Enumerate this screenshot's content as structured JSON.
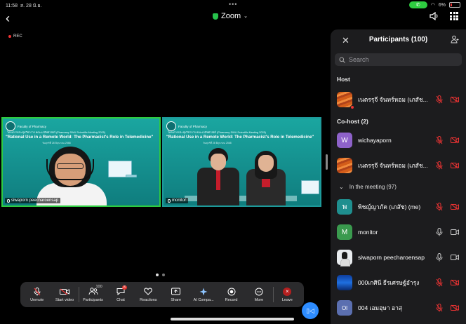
{
  "status": {
    "time": "11:58",
    "date": "ส. 28 มิ.ย.",
    "battery": "6%"
  },
  "topbar": {
    "app_name": "Zoom",
    "recording_label": "REC"
  },
  "tiles": [
    {
      "name": "siwaporn peecharoensap",
      "faculty": "Faculty of Pharmacy",
      "event": "โครงการประชุมวิชาการ คณะเภสัชศาสตร์ (Pharmacy SWU Scientific Meeting 2025)",
      "headline": "\"Rational Use in a Remote World: The Pharmacist's Role in Telemedicine\"",
      "subline": "วันศุกร์ที่ 28 มิถุนายน 2568"
    },
    {
      "name": "monitor",
      "faculty": "Faculty of Pharmacy",
      "event": "โครงการประชุมวิชาการ คณะเภสัชศาสตร์ (Pharmacy SWU Scientific Meeting 2025)",
      "headline": "\"Rational Use in a Remote World: The Pharmacist's Role in Telemedicine\"",
      "subline": "วันศุกร์ที่ 28 มิถุนายน 2568"
    }
  ],
  "toolbar": {
    "unmute": "Unmute",
    "start_video": "Start video",
    "participants": "Participants",
    "participants_count": "100",
    "chat": "Chat",
    "chat_badge": "8",
    "reactions": "Reactions",
    "share": "Share",
    "ai_companion": "AI Compa...",
    "record": "Record",
    "more": "More",
    "leave": "Leave"
  },
  "panel": {
    "title": "Participants (100)",
    "search_placeholder": "Search",
    "host_label": "Host",
    "cohost_label": "Co-host (2)",
    "meeting_label": "In the meeting (97)",
    "host": {
      "name": "เนตรรุจี จันทร์หอม (เภสัช...",
      "avatar_type": "orange-image"
    },
    "cohosts": [
      {
        "name": "wichayaporn",
        "initial": "W",
        "avatar_color": "#8e62c9"
      },
      {
        "name": "เนตรรุจี จันทร์หอม (เภสัช...",
        "avatar_type": "orange-image"
      }
    ],
    "attendees": [
      {
        "name": "พิชญ์ญาภัค (เภสัช) (me)",
        "initial": "พ",
        "avatar_color": "#1f8f8f"
      },
      {
        "name": "monitor",
        "initial": "M",
        "avatar_color": "#3a9a4e"
      },
      {
        "name": "siwaporn peecharoensap",
        "avatar_type": "person-image"
      },
      {
        "name": "000เกศินี ธีรเศรษฐ์อำรุง",
        "avatar_type": "blue-image"
      },
      {
        "name": "004 เอมอุษา อาสุ",
        "initial": "Ol",
        "avatar_color": "#5b6fb0"
      }
    ]
  }
}
